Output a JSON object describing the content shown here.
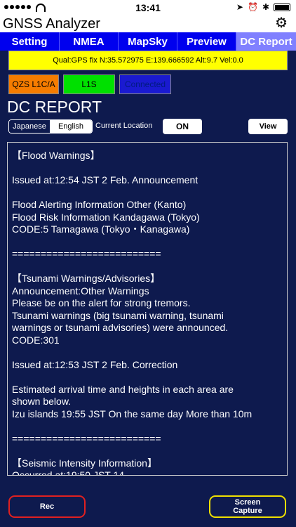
{
  "statusbar": {
    "time": "13:41"
  },
  "app": {
    "title": "GNSS Analyzer"
  },
  "tabs": [
    {
      "label": "Setting",
      "active": false
    },
    {
      "label": "NMEA",
      "active": false
    },
    {
      "label": "MapSky",
      "active": false
    },
    {
      "label": "Preview",
      "active": false
    },
    {
      "label": "DC Report",
      "active": true
    }
  ],
  "status_line": "Qual:GPS fix N:35.572975 E:139.666592 Alt:9.7 Vel:0.0",
  "chips": {
    "qzs": "QZS L1C/A",
    "l1s": "L1S",
    "connected": "Connected"
  },
  "heading": "DC REPORT",
  "controls": {
    "lang_japanese": "Japanese",
    "lang_english": "English",
    "current_location_label": "Current Location",
    "on_button": "ON",
    "view_button": "View"
  },
  "report_lines": [
    "【Flood Warnings】",
    "",
    "Issued at:12:54 JST 2 Feb. Announcement",
    "",
    "Flood Alerting Information Other (Kanto)",
    "Flood Risk Information Kandagawa (Tokyo)",
    "CODE:5 Tamagawa (Tokyo・Kanagawa)",
    "",
    "==========================",
    "",
    "【Tsunami Warnings/Advisories】",
    "Announcement:Other Warnings",
    "Please be on the alert for strong tremors.",
    "Tsunami warnings (big tsunami warning, tsunami",
    "warnings or tsunami advisories) were announced.",
    "CODE:301",
    "",
    "Issued at:12:53 JST 2 Feb. Correction",
    "",
    "Estimated arrival time and heights in each area are",
    "shown below.",
    "Izu islands 19:55 JST On the same day More than 10m",
    "",
    "==========================",
    "",
    "【Seismic Intensity Information】",
    "Occurred at:19:50  JST 14"
  ],
  "buttons": {
    "rec": "Rec",
    "capture_line1": "Screen",
    "capture_line2": "Capture"
  },
  "colors": {
    "background": "#0e1a4e",
    "tab": "#0000ee",
    "tab_active": "#8080ff",
    "status_line": "#ffff00",
    "qzs_chip": "#f57c00",
    "l1s_chip": "#00e000",
    "connected_chip": "#1a1ad0",
    "rec_border": "#e02020",
    "capture_border": "#f0e000"
  },
  "icons": {
    "settings": "gear-icon",
    "wifi": "wifi-icon",
    "battery": "battery-icon",
    "bluetooth": "bluetooth-icon"
  }
}
